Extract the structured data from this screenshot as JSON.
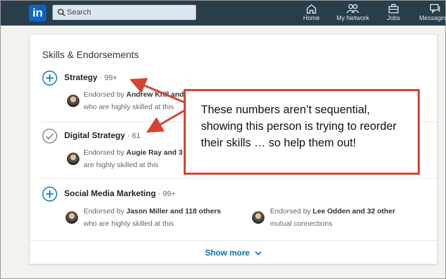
{
  "nav": {
    "logo_text": "in",
    "search_placeholder": "Search",
    "items": [
      {
        "label": "Home",
        "icon": "home-icon"
      },
      {
        "label": "My Network",
        "icon": "network-icon"
      },
      {
        "label": "Jobs",
        "icon": "briefcase-icon"
      },
      {
        "label": "Messaging",
        "icon": "chat-icon"
      }
    ],
    "colors": {
      "bar": "#283e4a",
      "brand": "#0a66c2"
    }
  },
  "card": {
    "title": "Skills & Endorsements",
    "skills": [
      {
        "name": "Strategy",
        "count": "99+",
        "icon": "add-circle-icon",
        "endorsements": [
          {
            "prefix": "Endorsed by ",
            "who": "Andrew Krill and",
            "line2": "who are highly skilled at this"
          }
        ]
      },
      {
        "name": "Digital Strategy",
        "count": "61",
        "icon": "check-circle-icon",
        "endorsements": [
          {
            "prefix": "Endorsed by ",
            "who": "Augie Ray and 3",
            "line2": "are highly skilled at this"
          }
        ]
      },
      {
        "name": "Social Media Marketing",
        "count": "99+",
        "icon": "add-circle-icon",
        "endorsements": [
          {
            "prefix": "Endorsed by ",
            "who": "Jason Miller and 118 others",
            "line2": "who are highly skilled at this"
          },
          {
            "prefix": "Endorsed by ",
            "who": "Lee Odden and 32 other",
            "line2": "mutual connections"
          }
        ]
      }
    ],
    "show_more": "Show more"
  },
  "annotation": {
    "text": "These numbers aren’t sequential, showing this person is trying to reorder their skills … so help them out!",
    "color": "#d4442f"
  }
}
